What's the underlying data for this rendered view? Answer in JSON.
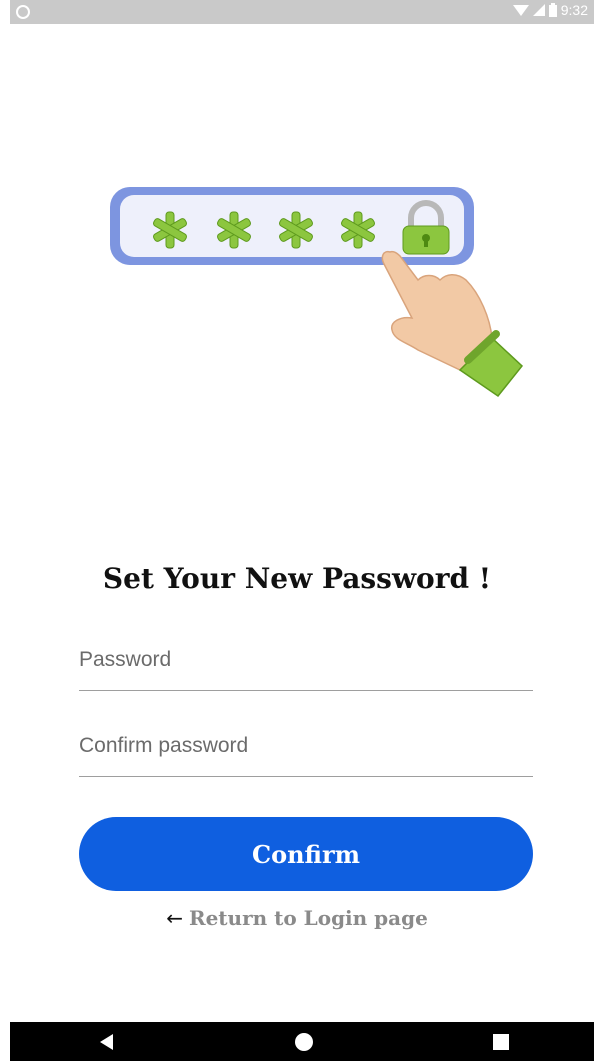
{
  "status_bar": {
    "time": "9:32",
    "icons": [
      "notification-icon",
      "wifi-icon",
      "signal-icon",
      "battery-icon"
    ]
  },
  "hero": {
    "asterisks": "* * * *",
    "icons": [
      "password-asterisk-icon",
      "lock-icon",
      "pointing-hand-icon"
    ]
  },
  "heading": "Set Your New Password !",
  "form": {
    "password_placeholder": "Password",
    "confirm_placeholder": "Confirm password",
    "confirm_label": "Confirm"
  },
  "return_link": {
    "arrow": "←",
    "label": "Return to Login page"
  },
  "colors": {
    "primary": "#0f5fe0",
    "asterisk_green": "#8cc63f",
    "frame_blue": "#7d95e0"
  },
  "nav_bar": {
    "icons": [
      "back-icon",
      "home-icon",
      "recents-icon"
    ]
  }
}
